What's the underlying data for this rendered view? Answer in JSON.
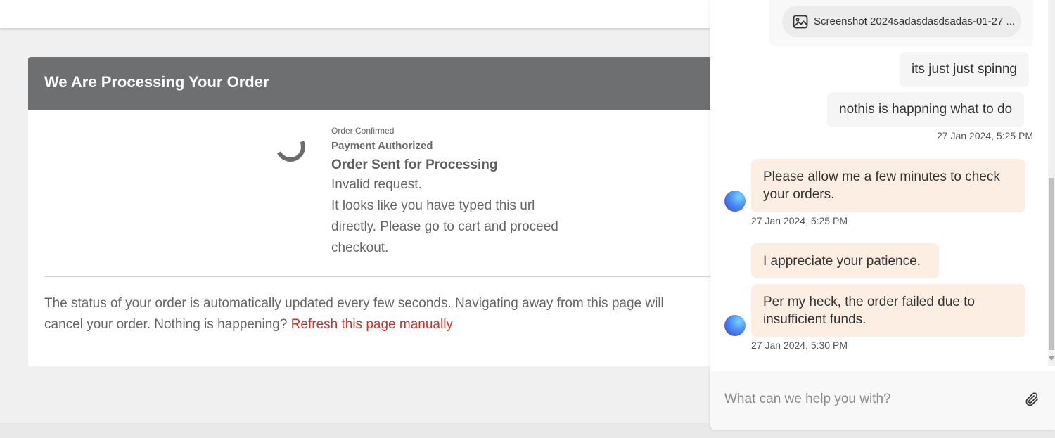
{
  "order": {
    "title": "We Are Processing Your Order",
    "step1": "Order Confirmed",
    "step2": "Payment Authorized",
    "step3": "Order Sent for Processing",
    "msg1": "Invalid request.",
    "msg2": "It looks like you have typed this url directly. Please go to cart and proceed checkout.",
    "status_line1": "The status of your order is automatically updated every few seconds. Navigating away from this page will",
    "status_line2": "cancel your order. Nothing is happening? ",
    "refresh_link": "Refresh this page manually"
  },
  "chat": {
    "attachment_name": "Screenshot 2024sadasdasdsadas-01-27 ...",
    "attachment_icon": "image-icon",
    "user_msg1": "its just just spinng",
    "user_msg2": "nothis is happning what to do",
    "user_ts": "27 Jan 2024, 5:25 PM",
    "agent_msg1": "Please allow me a few minutes to check your orders.",
    "agent_ts1": "27 Jan 2024, 5:25 PM",
    "agent_msg2": "I appreciate your patience.",
    "agent_msg3": "Per my heck, the order failed due to insufficient funds.",
    "agent_ts2": "27 Jan 2024, 5:30 PM",
    "input_placeholder": "What can we help you with?",
    "attach_icon": "paperclip-icon"
  }
}
